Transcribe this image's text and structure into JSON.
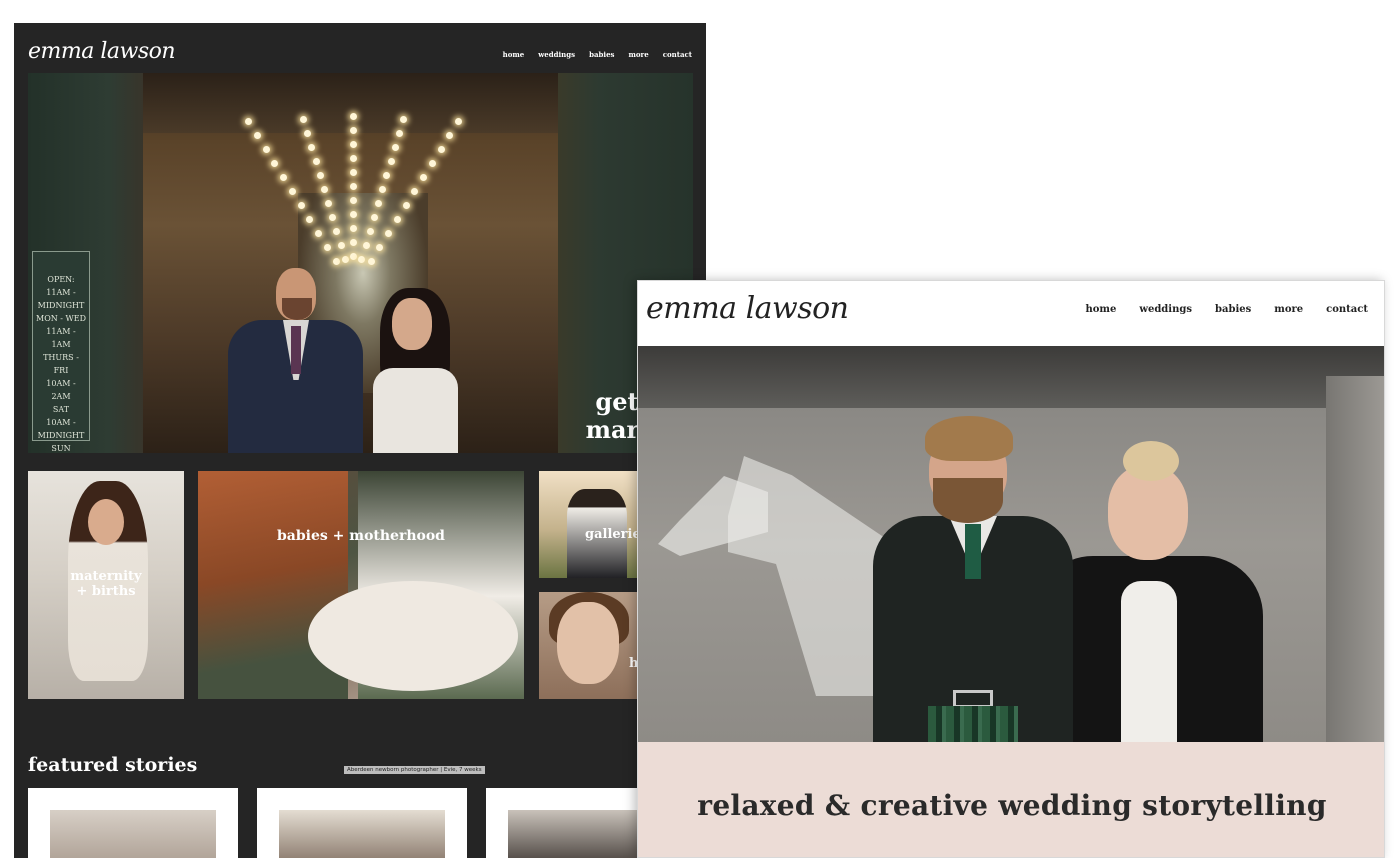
{
  "dark_site": {
    "logo": "emma lawson",
    "nav": [
      "home",
      "weddings",
      "babies",
      "more",
      "contact"
    ],
    "hero": {
      "caption": "getting\nmarried",
      "sign_text": "OPEN:\n11AM - MIDNIGHT\nMON - WED\n11AM - 1AM\nTHURS - FRI\n10AM - 2AM\nSAT\n10AM - MIDNIGHT\nSUN"
    },
    "tiles": {
      "maternity": "maternity\n+ births",
      "babies": "babies + motherhood",
      "galleries": "galleries",
      "portrait": "h"
    },
    "featured": {
      "title": "featured stories",
      "tag": "Aberdeen newborn photographer | Evie, 7 weeks"
    }
  },
  "light_site": {
    "logo": "emma lawson",
    "nav": [
      "home",
      "weddings",
      "babies",
      "more",
      "contact"
    ],
    "tagline": "relaxed & creative wedding storytelling"
  },
  "colors": {
    "dark_bg": "#252525",
    "pink_band": "#ecdcd6",
    "text_dark": "#2a2a2a"
  }
}
